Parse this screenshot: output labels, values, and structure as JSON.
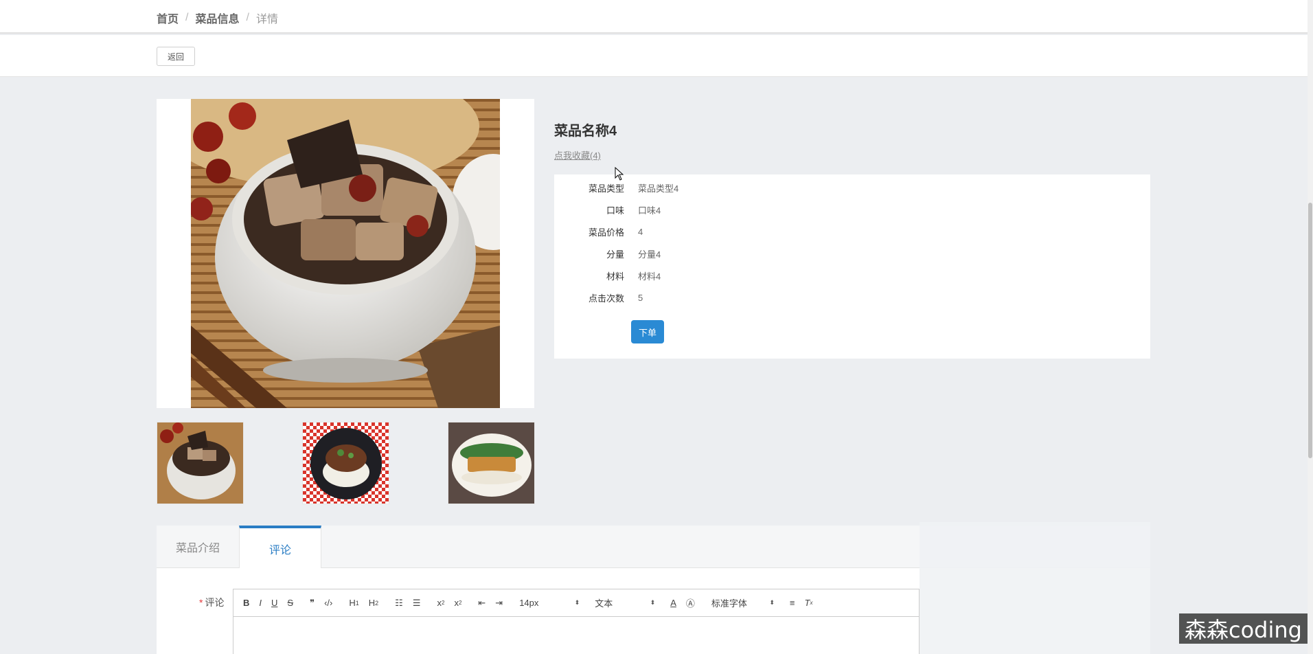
{
  "breadcrumb": {
    "home": "首页",
    "section": "菜品信息",
    "current": "详情",
    "separator": "/"
  },
  "toolbar": {
    "back_label": "返回"
  },
  "dish": {
    "name": "菜品名称4",
    "favorite_label": "点我收藏(4)",
    "fields": [
      {
        "label": "菜品类型",
        "value": "菜品类型4"
      },
      {
        "label": "口味",
        "value": "口味4"
      },
      {
        "label": "菜品价格",
        "value": "4"
      },
      {
        "label": "分量",
        "value": "分量4"
      },
      {
        "label": "材料",
        "value": "材料4"
      },
      {
        "label": "点击次数",
        "value": "5"
      }
    ],
    "order_label": "下单"
  },
  "tabs": [
    {
      "label": "菜品介绍",
      "active": false
    },
    {
      "label": "评论",
      "active": true
    }
  ],
  "comment": {
    "required_mark": "*",
    "label": "评论",
    "editor": {
      "font_size": "14px",
      "block_type": "文本",
      "font_family": "标准字体"
    }
  },
  "watermark": "森森coding",
  "colors": {
    "accent": "#2a8ad4",
    "tab_active": "#2a7dc4",
    "background": "#eceef1"
  }
}
